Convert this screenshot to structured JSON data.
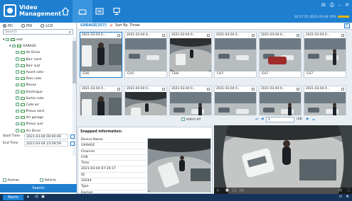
{
  "app": {
    "title_line1": "Video",
    "title_line2": "Management"
  },
  "header": {
    "clock": "16:57:55 2021-03-04 CPU:",
    "win_controls": [
      "⊟",
      "⎙",
      "–",
      "✕"
    ]
  },
  "left": {
    "modes": [
      {
        "label": "PD",
        "selected": true
      },
      {
        "label": "PID",
        "selected": false
      },
      {
        "label": "LCD",
        "selected": false
      }
    ],
    "search_placeholder": "Search",
    "tree": [
      {
        "label": "root",
        "level": 0,
        "kind": "folder"
      },
      {
        "label": "GARAGE",
        "level": 1,
        "kind": "folder"
      },
      {
        "label": "AV Drive",
        "level": 2,
        "kind": "cam"
      },
      {
        "label": "Barr nord",
        "level": 2,
        "kind": "cam"
      },
      {
        "label": "Barr sud",
        "level": 2,
        "kind": "cam"
      },
      {
        "label": "Avant cote",
        "level": 2,
        "kind": "cam"
      },
      {
        "label": "Pass cote",
        "level": 2,
        "kind": "cam"
      },
      {
        "label": "Pieces",
        "level": 2,
        "kind": "cam"
      },
      {
        "label": "Electrique",
        "level": 2,
        "kind": "cam"
      },
      {
        "label": "Sortie cote",
        "level": 2,
        "kind": "cam"
      },
      {
        "label": "Cote arr",
        "level": 2,
        "kind": "cam"
      },
      {
        "label": "Pneus nord",
        "level": 2,
        "kind": "cam"
      },
      {
        "label": "Arr garage",
        "level": 2,
        "kind": "cam"
      },
      {
        "label": "Pneus sud",
        "level": 2,
        "kind": "cam"
      },
      {
        "label": "Arr Drive",
        "level": 2,
        "kind": "cam"
      }
    ],
    "start_label": "Start Time",
    "start_value": "2021-03-04 00:00:00",
    "end_label": "End Time",
    "end_value": "2021-03-04 23:59:59",
    "human_label": "Human",
    "vehicle_label": "Vehicle",
    "search_button": "Search"
  },
  "tabs": {
    "active": "GARAGE[357]",
    "sort": "Sort By: Time▾"
  },
  "thumbs": [
    {
      "date": "2021-03-04 0...",
      "ch": "CH6",
      "scene": "person-car"
    },
    {
      "date": "2021-03-04 0...",
      "ch": "CH5",
      "scene": "street"
    },
    {
      "date": "2021-03-04 0...",
      "ch": "CH6",
      "scene": "garage"
    },
    {
      "date": "2021-03-04 0...",
      "ch": "CH7",
      "scene": "street"
    },
    {
      "date": "2021-03-04 0...",
      "ch": "CH7",
      "scene": "redcar"
    },
    {
      "date": "2021-03-04 0...",
      "ch": "CH7",
      "scene": "street-person"
    },
    {
      "date": "2021-03-04 0...",
      "ch": "",
      "scene": "person-car"
    },
    {
      "date": "2021-03-04 0...",
      "ch": "",
      "scene": "garage"
    },
    {
      "date": "2021-03-04 0...",
      "ch": "",
      "scene": "street-person"
    },
    {
      "date": "2021-03-04 0...",
      "ch": "",
      "scene": "street"
    },
    {
      "date": "2021-03-04 0...",
      "ch": "",
      "scene": "street-person"
    },
    {
      "date": "2021-03-04 0...",
      "ch": "",
      "scene": "street-person"
    }
  ],
  "pager": {
    "select_all": "select all",
    "page": "1",
    "total": "/18"
  },
  "snap": {
    "title": "Snapped information:",
    "rows": [
      "Device Name",
      "GARAGE",
      "Channel",
      "CH6",
      "Time",
      "2021-03-04 07:29:17",
      "ID",
      "19244",
      "Type",
      "Human"
    ]
  },
  "status": {
    "alarm": "Alarm"
  },
  "colors": {
    "brand": "#1e7fd0",
    "status_bar": "#16335a"
  }
}
